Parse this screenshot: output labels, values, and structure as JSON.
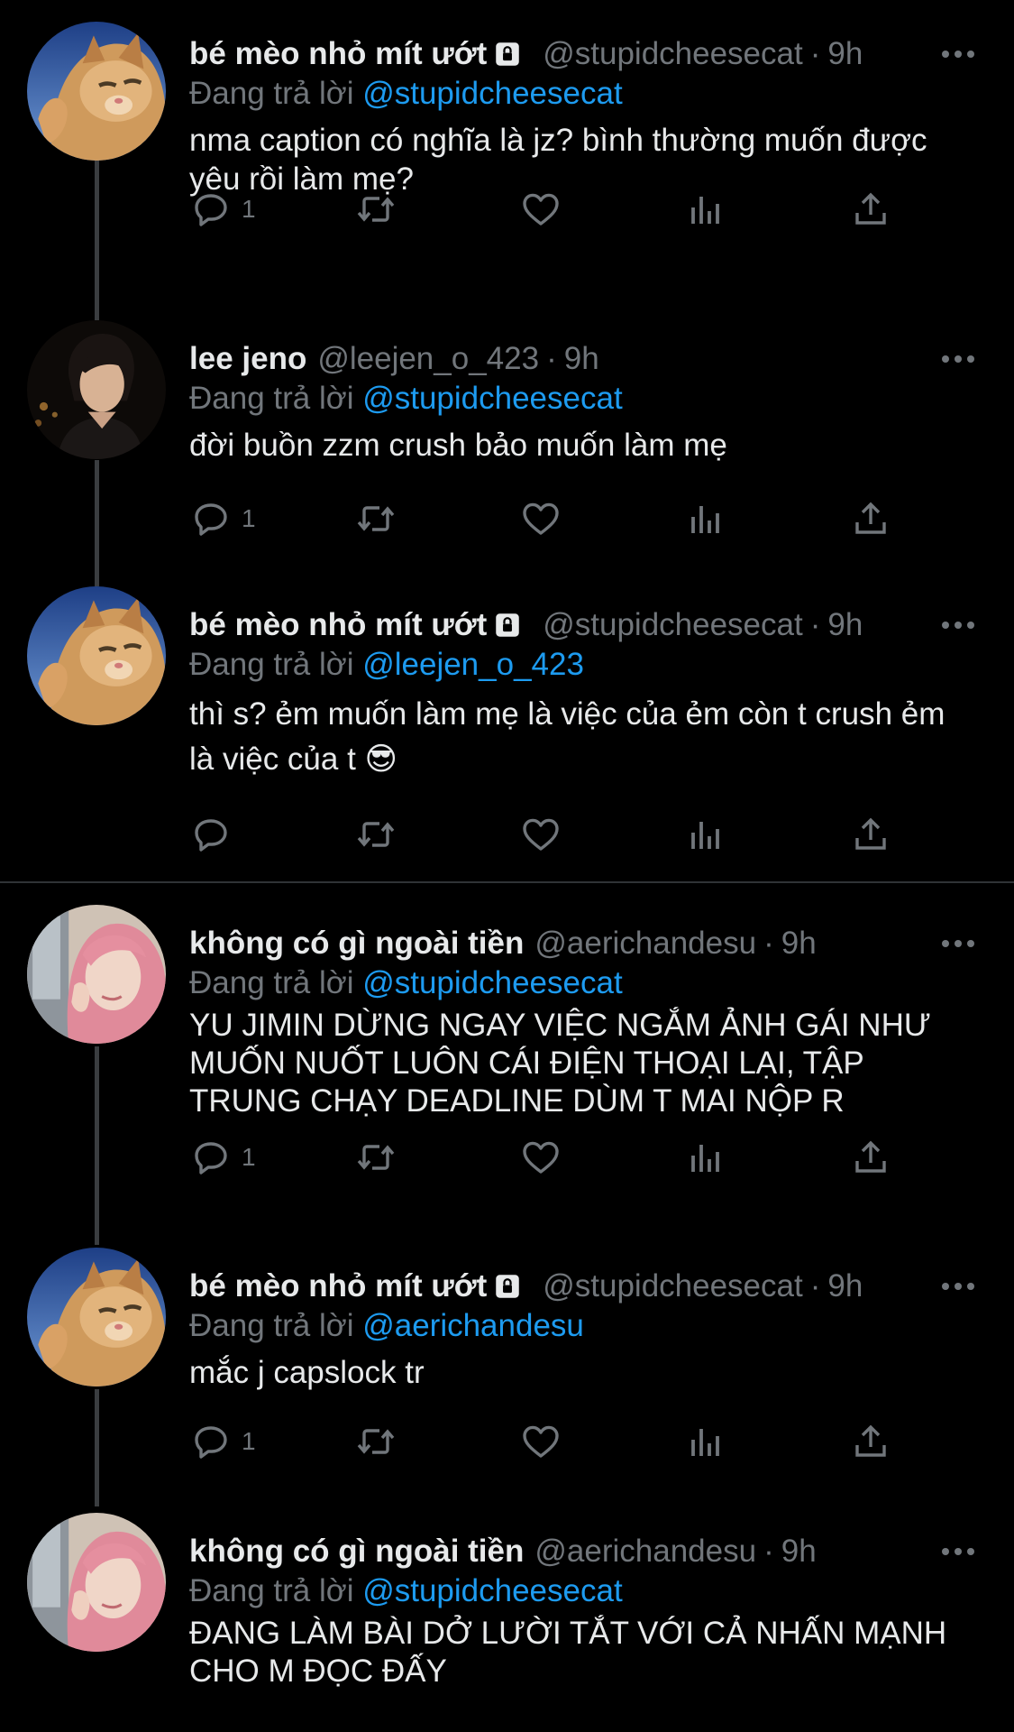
{
  "reply_prefix": "Đang trả lời",
  "colors": {
    "background": "#000000",
    "text": "#e7e9ea",
    "muted": "#71767b",
    "accent": "#1d9bf0"
  },
  "icons": {
    "more": "more-horizontal-icon",
    "lock": "lock-icon",
    "reply": "reply-icon",
    "retweet": "retweet-icon",
    "like": "heart-icon",
    "views": "views-icon",
    "share": "share-icon"
  },
  "tweets": [
    {
      "name": "bé mèo nhỏ mít ướt",
      "protected": true,
      "handle": "@stupidcheesecat",
      "time": "9h",
      "reply_to": "@stupidcheesecat",
      "text": "nma caption có nghĩa là jz? bình thường muốn được yêu rồi làm mẹ?",
      "reply_count": "1",
      "avatar": "cat"
    },
    {
      "name": "lee jeno",
      "protected": false,
      "handle": "@leejen_o_423",
      "time": "9h",
      "reply_to": "@stupidcheesecat",
      "text": "đời buồn zzm crush bảo muốn làm mẹ",
      "reply_count": "1",
      "avatar": "boy"
    },
    {
      "name": "bé mèo nhỏ mít ướt",
      "protected": true,
      "handle": "@stupidcheesecat",
      "time": "9h",
      "reply_to": "@leejen_o_423",
      "text": "thì s? ẻm muốn làm mẹ là việc của ẻm còn t crush ẻm là việc của t 😎",
      "reply_count": "",
      "avatar": "cat"
    },
    {
      "name": "không có gì ngoài tiền",
      "protected": false,
      "handle": "@aerichandesu",
      "time": "9h",
      "reply_to": "@stupidcheesecat",
      "text": "YU JIMIN DỪNG NGAY VIỆC NGẮM ẢNH GÁI NHƯ MUỐN NUỐT LUÔN CÁI ĐIỆN THOẠI LẠI, TẬP TRUNG CHẠY DEADLINE DÙM T MAI NỘP R",
      "reply_count": "1",
      "avatar": "girl"
    },
    {
      "name": "bé mèo nhỏ mít ướt",
      "protected": true,
      "handle": "@stupidcheesecat",
      "time": "9h",
      "reply_to": "@aerichandesu",
      "text": "mắc j capslock tr",
      "reply_count": "1",
      "avatar": "cat"
    },
    {
      "name": "không có gì ngoài tiền",
      "protected": false,
      "handle": "@aerichandesu",
      "time": "9h",
      "reply_to": "@stupidcheesecat",
      "text": "ĐANG LÀM BÀI DỞ LƯỜI TẮT VỚI CẢ NHẤN MẠNH CHO M ĐỌC ĐẤY",
      "reply_count": "",
      "avatar": "girl"
    }
  ]
}
